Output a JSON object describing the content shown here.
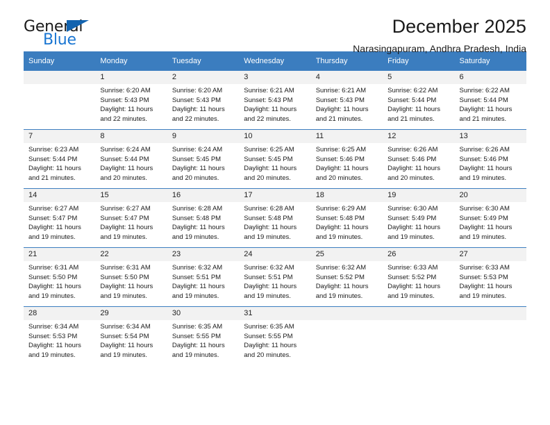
{
  "brand": {
    "word1": "General",
    "word2": "Blue",
    "accent_color": "#1263af",
    "blue_text_color": "#1a76d2"
  },
  "header": {
    "title": "December 2025",
    "subtitle": "Narasingapuram, Andhra Pradesh, India"
  },
  "calendar": {
    "header_bg": "#3b7dbf",
    "daynum_bg": "#f2f2f2",
    "weekday_headers": [
      "Sunday",
      "Monday",
      "Tuesday",
      "Wednesday",
      "Thursday",
      "Friday",
      "Saturday"
    ],
    "weeks": [
      [
        {
          "day": "",
          "lines": []
        },
        {
          "day": "1",
          "lines": [
            "Sunrise: 6:20 AM",
            "Sunset: 5:43 PM",
            "Daylight: 11 hours",
            "and 22 minutes."
          ]
        },
        {
          "day": "2",
          "lines": [
            "Sunrise: 6:20 AM",
            "Sunset: 5:43 PM",
            "Daylight: 11 hours",
            "and 22 minutes."
          ]
        },
        {
          "day": "3",
          "lines": [
            "Sunrise: 6:21 AM",
            "Sunset: 5:43 PM",
            "Daylight: 11 hours",
            "and 22 minutes."
          ]
        },
        {
          "day": "4",
          "lines": [
            "Sunrise: 6:21 AM",
            "Sunset: 5:43 PM",
            "Daylight: 11 hours",
            "and 21 minutes."
          ]
        },
        {
          "day": "5",
          "lines": [
            "Sunrise: 6:22 AM",
            "Sunset: 5:44 PM",
            "Daylight: 11 hours",
            "and 21 minutes."
          ]
        },
        {
          "day": "6",
          "lines": [
            "Sunrise: 6:22 AM",
            "Sunset: 5:44 PM",
            "Daylight: 11 hours",
            "and 21 minutes."
          ]
        }
      ],
      [
        {
          "day": "7",
          "lines": [
            "Sunrise: 6:23 AM",
            "Sunset: 5:44 PM",
            "Daylight: 11 hours",
            "and 21 minutes."
          ]
        },
        {
          "day": "8",
          "lines": [
            "Sunrise: 6:24 AM",
            "Sunset: 5:44 PM",
            "Daylight: 11 hours",
            "and 20 minutes."
          ]
        },
        {
          "day": "9",
          "lines": [
            "Sunrise: 6:24 AM",
            "Sunset: 5:45 PM",
            "Daylight: 11 hours",
            "and 20 minutes."
          ]
        },
        {
          "day": "10",
          "lines": [
            "Sunrise: 6:25 AM",
            "Sunset: 5:45 PM",
            "Daylight: 11 hours",
            "and 20 minutes."
          ]
        },
        {
          "day": "11",
          "lines": [
            "Sunrise: 6:25 AM",
            "Sunset: 5:46 PM",
            "Daylight: 11 hours",
            "and 20 minutes."
          ]
        },
        {
          "day": "12",
          "lines": [
            "Sunrise: 6:26 AM",
            "Sunset: 5:46 PM",
            "Daylight: 11 hours",
            "and 20 minutes."
          ]
        },
        {
          "day": "13",
          "lines": [
            "Sunrise: 6:26 AM",
            "Sunset: 5:46 PM",
            "Daylight: 11 hours",
            "and 19 minutes."
          ]
        }
      ],
      [
        {
          "day": "14",
          "lines": [
            "Sunrise: 6:27 AM",
            "Sunset: 5:47 PM",
            "Daylight: 11 hours",
            "and 19 minutes."
          ]
        },
        {
          "day": "15",
          "lines": [
            "Sunrise: 6:27 AM",
            "Sunset: 5:47 PM",
            "Daylight: 11 hours",
            "and 19 minutes."
          ]
        },
        {
          "day": "16",
          "lines": [
            "Sunrise: 6:28 AM",
            "Sunset: 5:48 PM",
            "Daylight: 11 hours",
            "and 19 minutes."
          ]
        },
        {
          "day": "17",
          "lines": [
            "Sunrise: 6:28 AM",
            "Sunset: 5:48 PM",
            "Daylight: 11 hours",
            "and 19 minutes."
          ]
        },
        {
          "day": "18",
          "lines": [
            "Sunrise: 6:29 AM",
            "Sunset: 5:48 PM",
            "Daylight: 11 hours",
            "and 19 minutes."
          ]
        },
        {
          "day": "19",
          "lines": [
            "Sunrise: 6:30 AM",
            "Sunset: 5:49 PM",
            "Daylight: 11 hours",
            "and 19 minutes."
          ]
        },
        {
          "day": "20",
          "lines": [
            "Sunrise: 6:30 AM",
            "Sunset: 5:49 PM",
            "Daylight: 11 hours",
            "and 19 minutes."
          ]
        }
      ],
      [
        {
          "day": "21",
          "lines": [
            "Sunrise: 6:31 AM",
            "Sunset: 5:50 PM",
            "Daylight: 11 hours",
            "and 19 minutes."
          ]
        },
        {
          "day": "22",
          "lines": [
            "Sunrise: 6:31 AM",
            "Sunset: 5:50 PM",
            "Daylight: 11 hours",
            "and 19 minutes."
          ]
        },
        {
          "day": "23",
          "lines": [
            "Sunrise: 6:32 AM",
            "Sunset: 5:51 PM",
            "Daylight: 11 hours",
            "and 19 minutes."
          ]
        },
        {
          "day": "24",
          "lines": [
            "Sunrise: 6:32 AM",
            "Sunset: 5:51 PM",
            "Daylight: 11 hours",
            "and 19 minutes."
          ]
        },
        {
          "day": "25",
          "lines": [
            "Sunrise: 6:32 AM",
            "Sunset: 5:52 PM",
            "Daylight: 11 hours",
            "and 19 minutes."
          ]
        },
        {
          "day": "26",
          "lines": [
            "Sunrise: 6:33 AM",
            "Sunset: 5:52 PM",
            "Daylight: 11 hours",
            "and 19 minutes."
          ]
        },
        {
          "day": "27",
          "lines": [
            "Sunrise: 6:33 AM",
            "Sunset: 5:53 PM",
            "Daylight: 11 hours",
            "and 19 minutes."
          ]
        }
      ],
      [
        {
          "day": "28",
          "lines": [
            "Sunrise: 6:34 AM",
            "Sunset: 5:53 PM",
            "Daylight: 11 hours",
            "and 19 minutes."
          ]
        },
        {
          "day": "29",
          "lines": [
            "Sunrise: 6:34 AM",
            "Sunset: 5:54 PM",
            "Daylight: 11 hours",
            "and 19 minutes."
          ]
        },
        {
          "day": "30",
          "lines": [
            "Sunrise: 6:35 AM",
            "Sunset: 5:55 PM",
            "Daylight: 11 hours",
            "and 19 minutes."
          ]
        },
        {
          "day": "31",
          "lines": [
            "Sunrise: 6:35 AM",
            "Sunset: 5:55 PM",
            "Daylight: 11 hours",
            "and 20 minutes."
          ]
        },
        {
          "day": "",
          "lines": []
        },
        {
          "day": "",
          "lines": []
        },
        {
          "day": "",
          "lines": []
        }
      ]
    ]
  }
}
